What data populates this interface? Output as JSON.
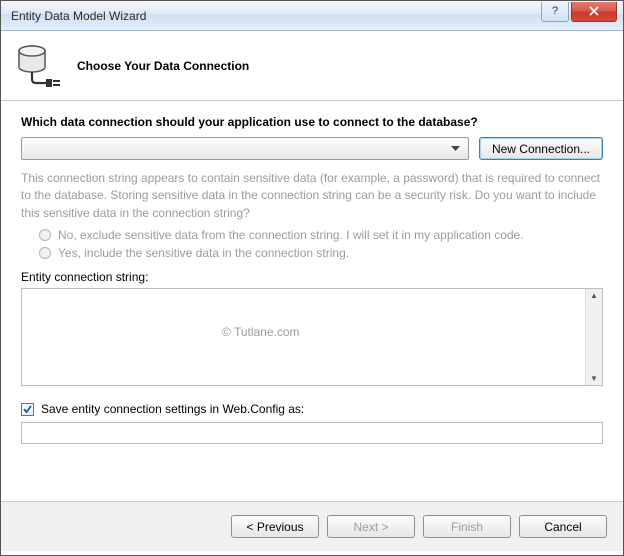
{
  "window": {
    "title": "Entity Data Model Wizard"
  },
  "header": {
    "title": "Choose Your Data Connection"
  },
  "body": {
    "prompt": "Which data connection should your application use to connect to the database?",
    "new_connection_label": "New Connection...",
    "sensitive_note": "This connection string appears to contain sensitive data (for example, a password) that is required to connect to the database. Storing sensitive data in the connection string can be a security risk. Do you want to include this sensitive data in the connection string?",
    "radio_exclude": "No, exclude sensitive data from the connection string. I will set it in my application code.",
    "radio_include": "Yes, include the sensitive data in the connection string.",
    "entity_string_label": "Entity connection string:",
    "watermark": "© Tutlane.com",
    "save_settings_label": "Save entity connection settings in Web.Config as:",
    "connection_selected": "",
    "entity_string_value": "",
    "save_as_value": "",
    "save_checked": true
  },
  "footer": {
    "previous": "< Previous",
    "next": "Next >",
    "finish": "Finish",
    "cancel": "Cancel"
  }
}
